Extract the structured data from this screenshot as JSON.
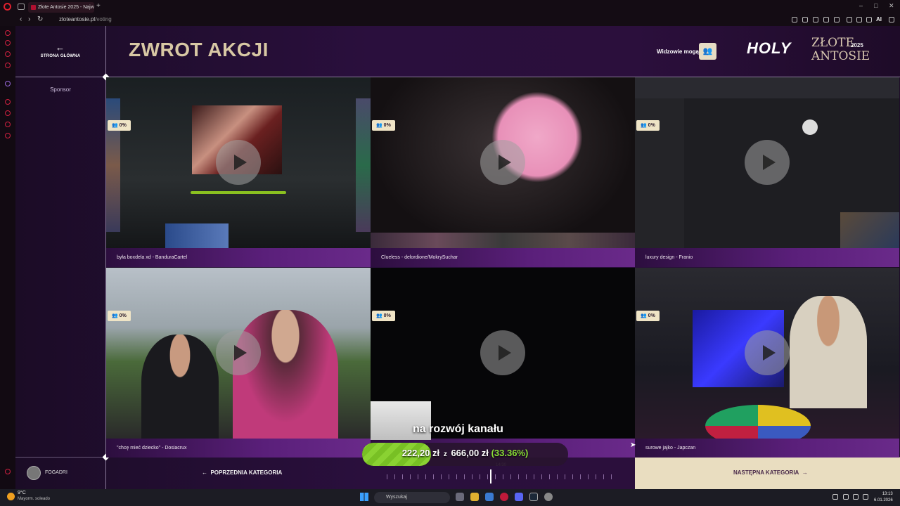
{
  "browser": {
    "tab_title": "Złote Antosie 2025 - Najw",
    "new_tab": "+",
    "url_host": "zloteantosie.pl",
    "url_path": "/voting",
    "ai_label": "AI"
  },
  "header": {
    "home_label": "STRONA GŁÓWNA",
    "page_title": "ZWROT AKCJI",
    "viewers_label": "Widzowie mogą",
    "brand_word": "HOLY",
    "brand_name_line1": "ZŁOTE",
    "brand_name_line2": "ANTOSIE",
    "brand_year": "2025"
  },
  "sidebar": {
    "sponsor_label": "Sponsor"
  },
  "nominees": [
    {
      "caption": "była boxdela xd - BanduraCartel",
      "percent": "0%"
    },
    {
      "caption": "Clueless - delordione/MokrySuchar",
      "percent": "0%"
    },
    {
      "caption": "luxury design - Franio",
      "percent": "0%"
    },
    {
      "caption": "\"chcę mieć dziecko\" - Dosiacrux",
      "percent": "0%"
    },
    {
      "caption": "",
      "percent": "0%"
    },
    {
      "caption": "surowe jajko - Japczan",
      "percent": "0%"
    }
  ],
  "footer": {
    "username": "FOGADRI",
    "prev_label": "POPRZEDNIA KATEGORIA",
    "next_label": "NASTĘPNA KATEGORIA",
    "timeline_count": "14/30"
  },
  "donation": {
    "title": "na rozwój kanału",
    "current": "222,20 zł",
    "separator": "z",
    "goal": "666,00 zł",
    "percent_text": "(33.36%)",
    "progress": 0.3336
  },
  "taskbar": {
    "temperature": "9°C",
    "condition": "Mayorm. soleado",
    "search_placeholder": "Wyszukaj",
    "time": "13:13",
    "date": "6.01.2026"
  },
  "colors": {
    "accent_cream": "#e9ddc0",
    "progress_green": "#8ad232",
    "title_gold": "#d8c8a4"
  }
}
